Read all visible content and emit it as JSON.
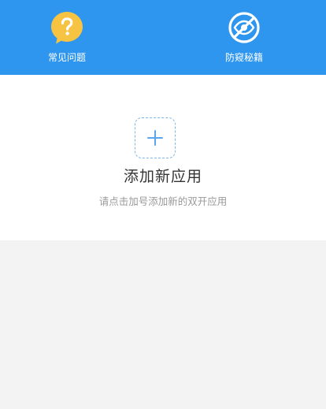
{
  "header": {
    "background_color": "#2e96ee",
    "items": [
      {
        "label": "常见问题",
        "icon": "question-bubble-icon",
        "icon_color": "#f6c343"
      },
      {
        "label": "防窥秘籍",
        "icon": "no-peeking-icon",
        "icon_color": "#ffffff"
      }
    ]
  },
  "main": {
    "add_icon": "plus-icon",
    "accent_color": "#5aa6ee",
    "title": "添加新应用",
    "subtitle": "请点击加号添加新的双开应用"
  }
}
